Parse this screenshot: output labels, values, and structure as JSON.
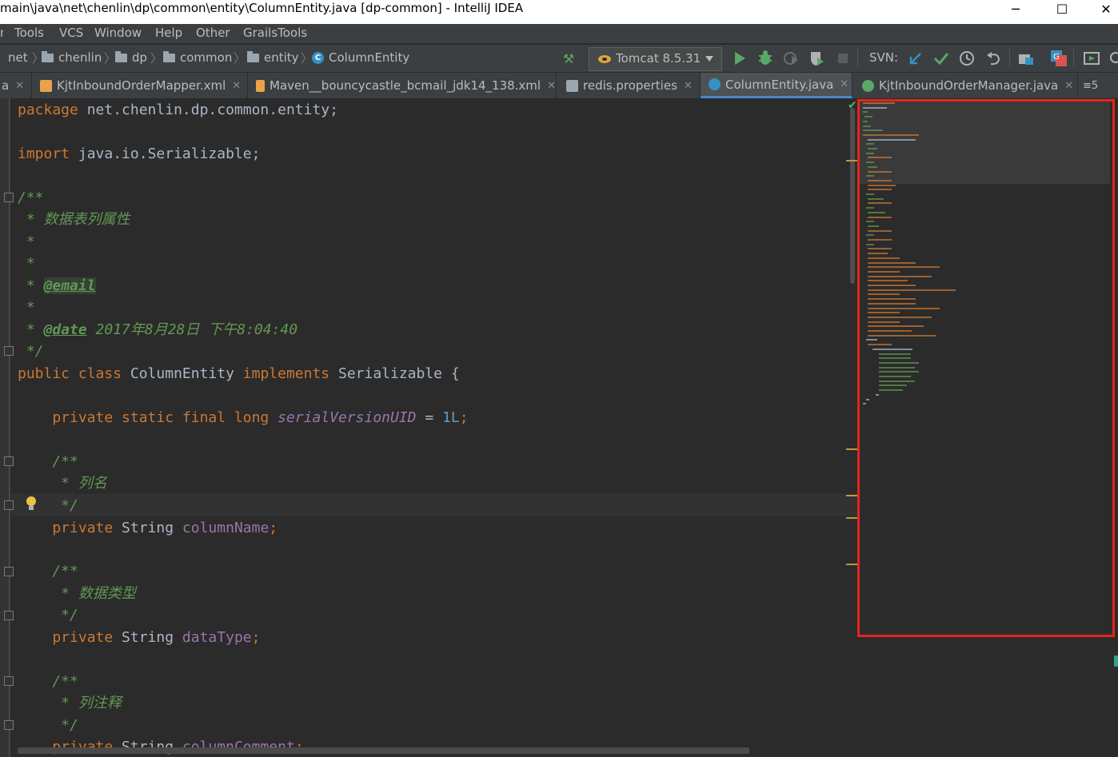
{
  "window": {
    "title": "main\\java\\net\\chenlin\\dp\\common\\entity\\ColumnEntity.java [dp-common] - IntelliJ IDEA",
    "minimize": "─",
    "maximize": "☐",
    "close": "✕"
  },
  "menu": [
    {
      "label": "Tools"
    },
    {
      "label": "VCS"
    },
    {
      "label": "Window"
    },
    {
      "label": "Help"
    },
    {
      "label": "Other"
    },
    {
      "label": "GrailsTools"
    }
  ],
  "breadcrumb": [
    {
      "label": "net"
    },
    {
      "label": "chenlin"
    },
    {
      "label": "dp"
    },
    {
      "label": "common"
    },
    {
      "label": "entity"
    },
    {
      "label": "ColumnEntity"
    }
  ],
  "toolbar": {
    "run_config": "Tomcat 8.5.31",
    "svn_label": "SVN:"
  },
  "tabs": [
    {
      "label": "KjtInboundOrderMapper.xml",
      "active": false
    },
    {
      "label": "Maven__bouncycastle_bcmail_jdk14_138.xml",
      "active": false
    },
    {
      "label": "redis.properties",
      "active": false
    },
    {
      "label": "ColumnEntity.java",
      "active": true
    },
    {
      "label": "KjtInboundOrderManager.java",
      "active": false
    }
  ],
  "tabs_overflow": "≡5",
  "code": {
    "l1_kw": "package",
    "l1_rest": " net.chenlin.dp.common.entity;",
    "l2_kw": "import",
    "l2_rest": " java.io.Serializable;",
    "l3": "/**",
    "l4": " * 数据表列属性",
    "l5": " *",
    "l6": " *",
    "l7_pre": " * ",
    "l7_tag": "@email",
    "l8": " *",
    "l9_pre": " * ",
    "l9_tag": "@date",
    "l9_rest": " 2017年8月28日 下午8:04:40",
    "l10": " */",
    "l11_kw1": "public class",
    "l11_name": " ColumnEntity ",
    "l11_kw2": "implements",
    "l11_rest": " Serializable {",
    "l12_kw": "    private static final long ",
    "l12_field": "serialVersionUID",
    "l12_eq": " = ",
    "l12_num": "1L",
    "l12_end": ";",
    "l13": "    /**",
    "l14": "     * 列名",
    "l15": "     */",
    "l16_kw": "    private",
    "l16_type": " String ",
    "l16_field": "columnName",
    "l16_end": ";",
    "l17": "    /**",
    "l18": "     * 数据类型",
    "l19": "     */",
    "l20_kw": "    private",
    "l20_type": " String ",
    "l20_field": "dataType",
    "l20_end": ";",
    "l21": "    /**",
    "l22": "     * 列注释",
    "l23": "     */",
    "l24_kw": "    private",
    "l24_type": " String ",
    "l24_field": "columnComment",
    "l24_end": ";"
  },
  "colors": {
    "keyword": "#cc7832",
    "doc_comment": "#629755",
    "field": "#9876aa",
    "number": "#6897bb",
    "highlight_border": "#e8231d"
  }
}
